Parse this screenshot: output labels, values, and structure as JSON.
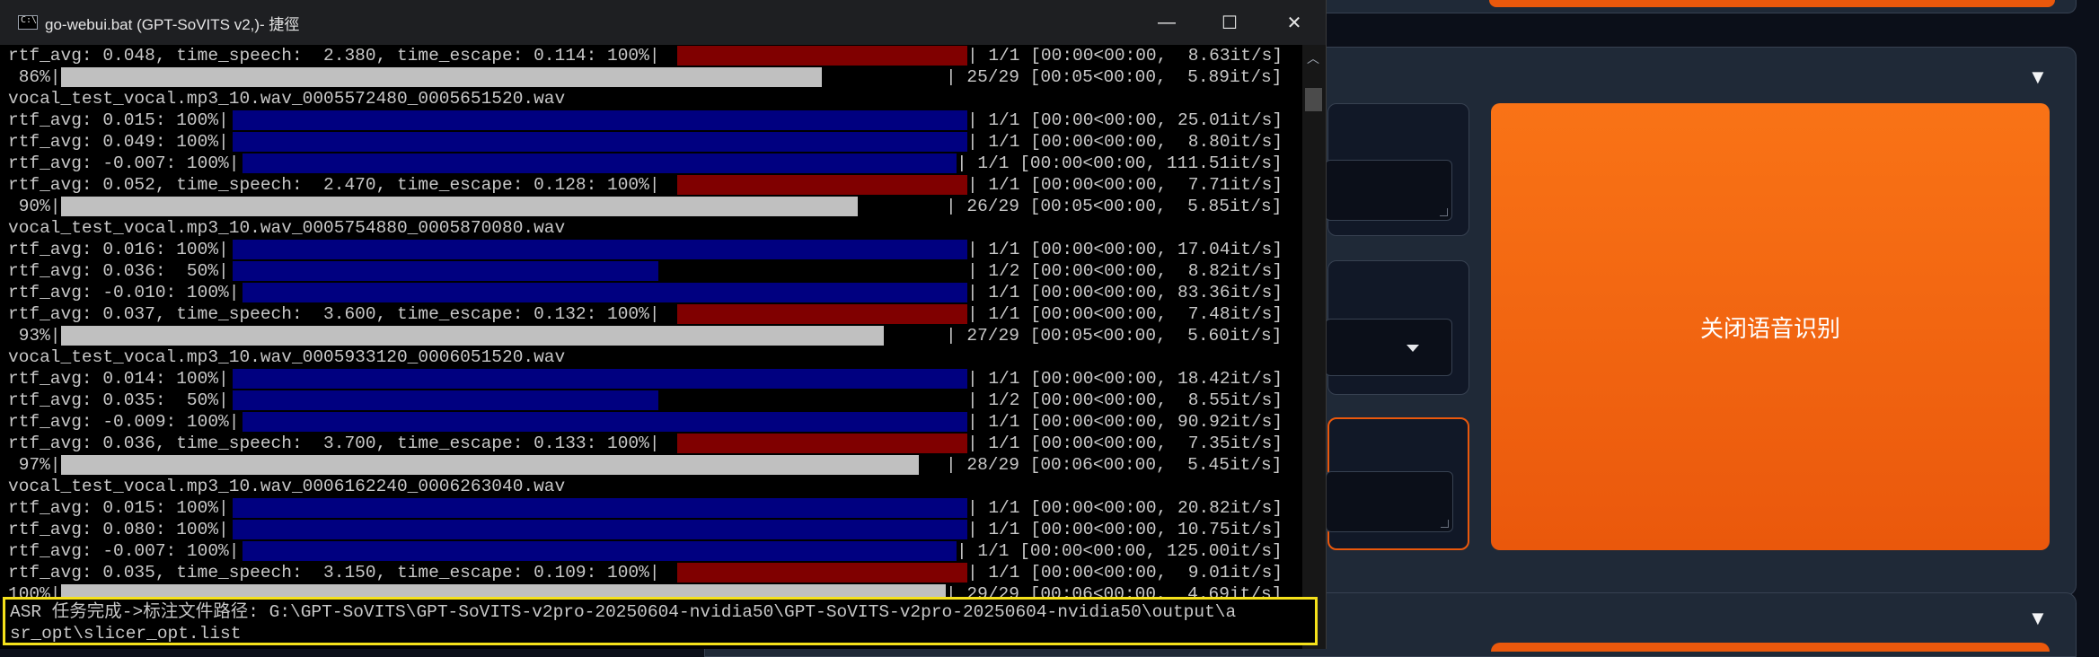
{
  "window": {
    "title": "go-webui.bat (GPT-SoVITS v2,)- 捷徑",
    "minimize": "—",
    "maximize": "☐",
    "close": "✕",
    "icon_glyph": "C:\\"
  },
  "webui": {
    "collapse_arrow": "▼",
    "asr_button_label": "关闭语音识别",
    "accent_color": "#ea580c"
  },
  "console": {
    "lines": [
      "rtf_avg: 0.048, time_speech:  2.380, time_escape: 0.114: 100%|",
      "| 1/1 [00:00<00:00,  8.63it/s]",
      " 86%|",
      "| 25/29 [00:05<00:00,  5.89it/s]",
      "vocal_test_vocal.mp3_10.wav_0005572480_0005651520.wav",
      "rtf_avg: 0.015: 100%|",
      "| 1/1 [00:00<00:00, 25.01it/s]",
      "rtf_avg: 0.049: 100%|",
      "| 1/1 [00:00<00:00,  8.80it/s]",
      "rtf_avg: -0.007: 100%|",
      "| 1/1 [00:00<00:00, 111.51it/s]",
      "rtf_avg: 0.052, time_speech:  2.470, time_escape: 0.128: 100%|",
      "| 1/1 [00:00<00:00,  7.71it/s]",
      " 90%|",
      "| 26/29 [00:05<00:00,  5.85it/s]",
      "vocal_test_vocal.mp3_10.wav_0005754880_0005870080.wav",
      "rtf_avg: 0.016: 100%|",
      "| 1/1 [00:00<00:00, 17.04it/s]",
      "rtf_avg: 0.036:  50%|",
      "| 1/2 [00:00<00:00,  8.82it/s]",
      "rtf_avg: -0.010: 100%|",
      "| 1/1 [00:00<00:00, 83.36it/s]",
      "rtf_avg: 0.037, time_speech:  3.600, time_escape: 0.132: 100%|",
      "| 1/1 [00:00<00:00,  7.48it/s]",
      " 93%|",
      "| 27/29 [00:05<00:00,  5.60it/s]",
      "vocal_test_vocal.mp3_10.wav_0005933120_0006051520.wav",
      "rtf_avg: 0.014: 100%|",
      "| 1/1 [00:00<00:00, 18.42it/s]",
      "rtf_avg: 0.035:  50%|",
      "| 1/2 [00:00<00:00,  8.55it/s]",
      "rtf_avg: -0.009: 100%|",
      "| 1/1 [00:00<00:00, 90.92it/s]",
      "rtf_avg: 0.036, time_speech:  3.700, time_escape: 0.133: 100%|",
      "| 1/1 [00:00<00:00,  7.35it/s]",
      " 97%|",
      "| 28/29 [00:06<00:00,  5.45it/s]",
      "vocal_test_vocal.mp3_10.wav_0006162240_0006263040.wav",
      "rtf_avg: 0.015: 100%|",
      "| 1/1 [00:00<00:00, 20.82it/s]",
      "rtf_avg: 0.080: 100%|",
      "| 1/1 [00:00<00:00, 10.75it/s]",
      "rtf_avg: -0.007: 100%|",
      "| 1/1 [00:00<00:00, 125.00it/s]",
      "rtf_avg: 0.035, time_speech:  3.150, time_escape: 0.109: 100%|",
      "| 1/1 [00:00<00:00,  9.01it/s]",
      "100%|",
      "| 29/29 [00:06<00:00,  4.69it/s]"
    ],
    "asr_done_line1": "ASR 任务完成->标注文件路径: G:\\GPT-SoVITS\\GPT-SoVITS-v2pro-20250604-nvidia50\\GPT-SoVITS-v2pro-20250604-nvidia50\\output\\a",
    "asr_done_line2": "sr_opt\\slicer_opt.list",
    "colors": {
      "blue_bar": "#000080",
      "red_bar": "#800000",
      "grey_bar": "#c0c0c0"
    }
  },
  "progress": {
    "overall": [
      0.86,
      0.9,
      0.93,
      0.97,
      1.0
    ],
    "half_steps": [
      0.5,
      0.5
    ]
  }
}
